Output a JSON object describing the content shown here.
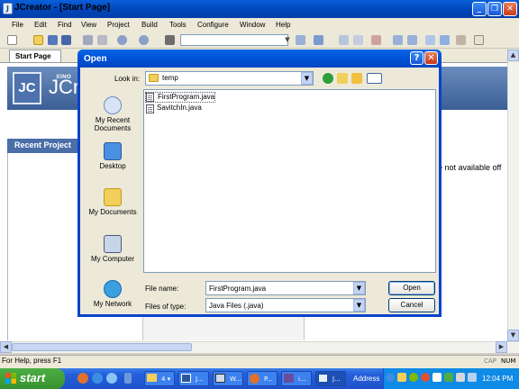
{
  "app": {
    "title": "JCreator - [Start Page]",
    "logo_letter": "J"
  },
  "window_controls": {
    "minimize": "_",
    "maximize": "❐",
    "close": "✕"
  },
  "menu": [
    "File",
    "Edit",
    "Find",
    "View",
    "Project",
    "Build",
    "Tools",
    "Configure",
    "Window",
    "Help"
  ],
  "tabs": {
    "start_page": "Start Page",
    "close": "×"
  },
  "start_page": {
    "logo": "JC",
    "brand_text": "JCr",
    "xino_text": "XINO",
    "recent_header": "Recent Project",
    "not_available": "e not available off"
  },
  "scroll": {
    "up": "▲",
    "down": "▼",
    "left": "◀",
    "right": "▶"
  },
  "status": {
    "text": "For Help, press F1",
    "cap": "CAP",
    "num": "NUM"
  },
  "taskbar": {
    "start_label": "start",
    "buttons": [
      {
        "label": "4 ▾"
      },
      {
        "label": "J..."
      },
      {
        "label": "W..."
      },
      {
        "label": "P..."
      },
      {
        "label": "i..."
      },
      {
        "label": "J..."
      }
    ],
    "address_label": "Address",
    "clock": "12:04 PM"
  },
  "dialog": {
    "title": "Open",
    "help": "?",
    "close": "✕",
    "look_in_label": "Look in:",
    "look_in_value": "temp",
    "places": [
      "My Recent Documents",
      "Desktop",
      "My Documents",
      "My Computer",
      "My Network"
    ],
    "files": [
      "FirstProgram.java",
      "SavitchIn.java"
    ],
    "file_name_label": "File name:",
    "file_name_value": "FirstProgram.java",
    "file_type_label": "Files of type:",
    "file_type_value": "Java Files (.java)",
    "open_button": "Open",
    "cancel_button": "Cancel",
    "dropdown_arrow": "▼"
  },
  "colors": {
    "title_blue": "#0a5fd8",
    "recent_header_blue": "#4a6ea8",
    "taskbar_blue": "#245edb",
    "start_green": "#37922f"
  }
}
